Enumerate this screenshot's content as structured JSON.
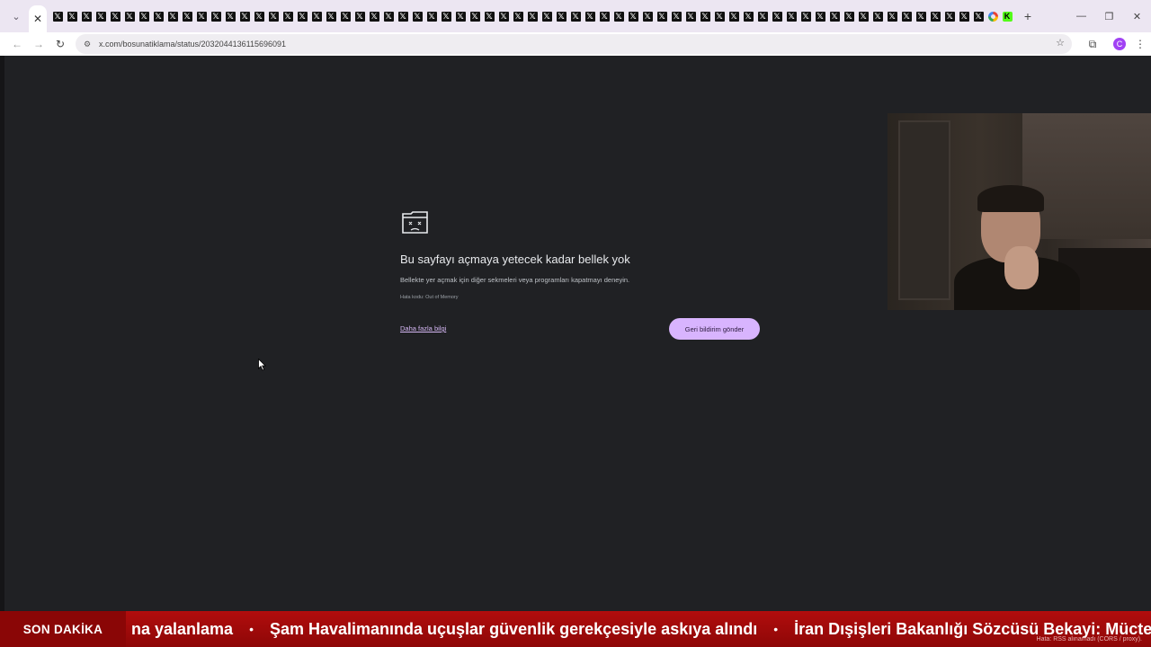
{
  "browser": {
    "url": "x.com/bosunatiklama/status/2032044136115696091",
    "tab_count_x": 65,
    "accent": "#d8b4fe",
    "profile_initial": "C"
  },
  "error_page": {
    "title": "Bu sayfayı açmaya yetecek kadar bellek yok",
    "message": "Bellekte yer açmak için diğer sekmeleri veya programları kapatmayı deneyin.",
    "error_code": "Hata kodu: Out of Memory",
    "learn_more": "Daha fazla bilgi",
    "feedback_button": "Geri bildirim gönder"
  },
  "ticker": {
    "label": "SON DAKİKA",
    "items": [
      "na yalanlama",
      "Şam Havalimanında uçuşlar güvenlik gerekçesiyle askıya alındı",
      "İran Dışişleri Bakanlığı Sözcüsü Bekayi: Mücte"
    ],
    "separator": "•",
    "note": "Hata: RSS alınamadı (CORS / proxy).",
    "color": "#b10d0d"
  }
}
